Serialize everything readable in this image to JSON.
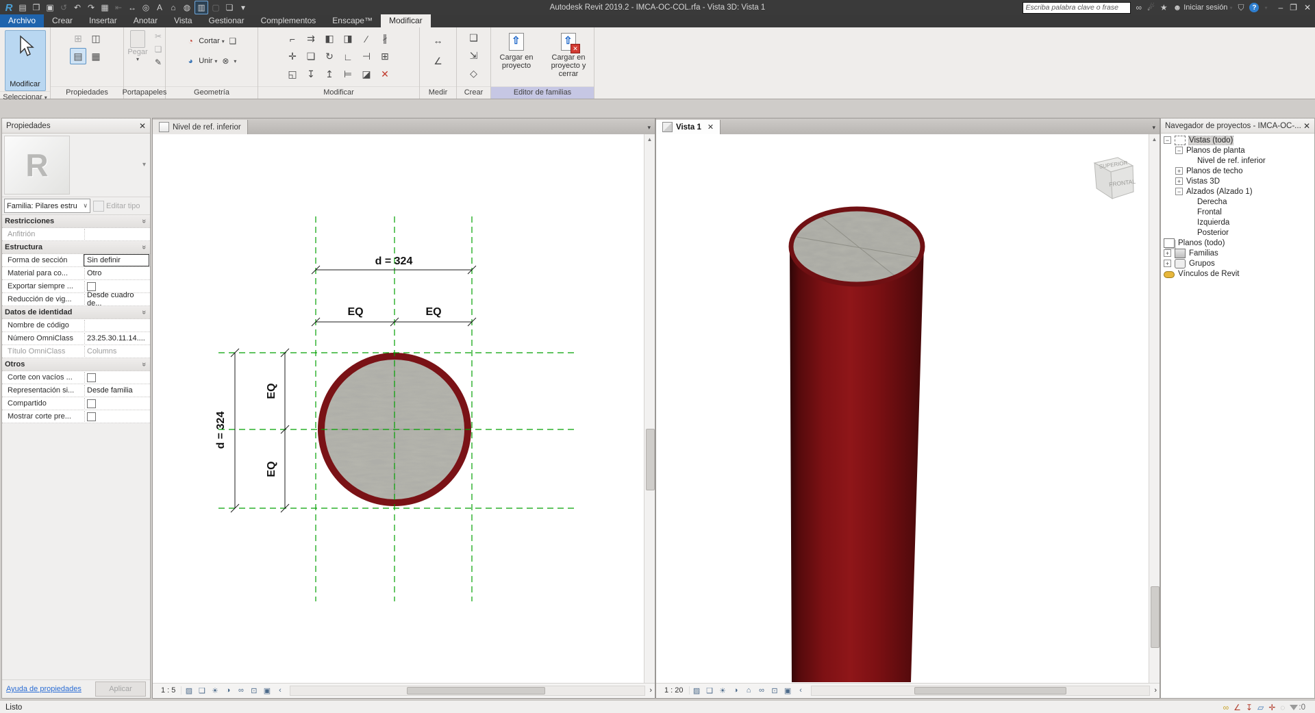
{
  "glyphs": {
    "close": "✕",
    "dropdown": "▾",
    "chevron": "»",
    "minimize": "–",
    "restore": "❐",
    "left_collapse": "‹",
    "right_arrow": "›",
    "up": "▲",
    "down": "▼"
  },
  "title_bar": {
    "title": "Autodesk Revit 2019.2 - IMCA-OC-COL.rfa - Vista 3D: Vista 1",
    "search_placeholder": "Escriba palabra clave o frase",
    "sign_in_label": "Iniciar sesión",
    "qat": [
      {
        "name": "revit-logo",
        "g": "R",
        "logo": true
      },
      {
        "name": "project-properties-icon",
        "g": "▤"
      },
      {
        "name": "open-icon",
        "g": "❒"
      },
      {
        "name": "save-icon",
        "g": "▣"
      },
      {
        "name": "sync-icon",
        "g": "↺",
        "dim": true
      },
      {
        "name": "undo-icon",
        "g": "↶"
      },
      {
        "name": "redo-icon",
        "g": "↷"
      },
      {
        "name": "print-icon",
        "g": "▦"
      },
      {
        "name": "measure-icon",
        "g": "⇤",
        "dim": true
      },
      {
        "name": "aligned-dimension-icon",
        "g": "↔"
      },
      {
        "name": "tag-icon",
        "g": "◎"
      },
      {
        "name": "text-icon",
        "g": "A"
      },
      {
        "name": "default-3d-view-icon",
        "g": "⌂"
      },
      {
        "name": "render-icon",
        "g": "◍"
      },
      {
        "name": "thin-lines-icon",
        "g": "▥",
        "boxed": true
      },
      {
        "name": "close-hidden-windows-icon",
        "g": "▢",
        "dim": true
      },
      {
        "name": "switch-windows-icon",
        "g": "❏"
      },
      {
        "name": "customize-qat-icon",
        "g": "▾"
      }
    ]
  },
  "tabs": [
    {
      "label": "Archivo",
      "archivo": true
    },
    {
      "label": "Crear"
    },
    {
      "label": "Insertar"
    },
    {
      "label": "Anotar"
    },
    {
      "label": "Vista"
    },
    {
      "label": "Gestionar"
    },
    {
      "label": "Complementos"
    },
    {
      "label": "Enscape™"
    },
    {
      "label": "Modificar",
      "active": true
    }
  ],
  "ribbon": {
    "select_big_label": "Modificar",
    "paste_label": "Pegar",
    "cut_label": "Cortar",
    "join_label": "Unir",
    "load_line1": "Cargar en",
    "load_line2": "proyecto",
    "loadclose_line1": "Cargar en",
    "loadclose_line2": "proyecto y cerrar",
    "panel_labels": {
      "select": "Seleccionar",
      "properties": "Propiedades",
      "clipboard": "Portapapeles",
      "geometry": "Geometría",
      "modify": "Modificar",
      "measure": "Medir",
      "create": "Crear",
      "family_editor": "Editor de familias"
    },
    "properties_icons": [
      {
        "name": "properties-palette-icon",
        "g": "⊞",
        "dim": true
      },
      {
        "name": "family-category-icon",
        "g": "◫"
      },
      {
        "name": "properties-toggle-icon",
        "g": "▤",
        "active": true
      },
      {
        "name": "family-types-icon",
        "g": "▦"
      }
    ],
    "clipboard_icons": [
      {
        "name": "cut-to-clipboard-icon",
        "g": "✂",
        "dim": true
      },
      {
        "name": "copy-to-clipboard-icon",
        "g": "❏",
        "dim": true
      },
      {
        "name": "match-type-icon",
        "g": "✎"
      }
    ],
    "geometry_icons": {
      "cut_icon": "◔",
      "cube_icon": "❑",
      "join_icon": "◕",
      "attach_icon": "⊗"
    },
    "modify_icons": [
      {
        "name": "align-icon",
        "g": "⌐"
      },
      {
        "name": "offset-icon",
        "g": "⇉"
      },
      {
        "name": "mirror-pick-axis-icon",
        "g": "◧"
      },
      {
        "name": "mirror-draw-axis-icon",
        "g": "◨"
      },
      {
        "name": "split-element-icon",
        "g": "∕"
      },
      {
        "name": "split-with-gap-icon",
        "g": "∦"
      },
      {
        "name": "move-icon",
        "g": "✛"
      },
      {
        "name": "copy-icon",
        "g": "❏"
      },
      {
        "name": "rotate-icon",
        "g": "↻"
      },
      {
        "name": "trim-corner-icon",
        "g": "∟"
      },
      {
        "name": "trim-extend-single-icon",
        "g": "⊣"
      },
      {
        "name": "array-icon",
        "g": "⊞"
      },
      {
        "name": "scale-icon",
        "g": "◱"
      },
      {
        "name": "pin-icon",
        "g": "↧"
      },
      {
        "name": "unpin-icon",
        "g": "↥"
      },
      {
        "name": "trim-extend-multiple-icon",
        "g": "⊨"
      },
      {
        "name": "split-face-icon",
        "g": "◪"
      },
      {
        "name": "delete-icon",
        "g": "✕",
        "red": true
      }
    ],
    "measure_icons": [
      {
        "name": "measure-length-icon",
        "g": "↔"
      },
      {
        "name": "angular-dimension-icon",
        "g": "∠"
      }
    ],
    "create_icons": [
      {
        "name": "component-in-place-icon",
        "g": "❑"
      },
      {
        "name": "transfer-small-icon",
        "g": "⇲"
      },
      {
        "name": "diamond-small-icon",
        "g": "◇"
      }
    ]
  },
  "properties_palette": {
    "header": "Propiedades",
    "type_selector": "Familia: Pilares estru",
    "edit_type_label": "Editar tipo",
    "rows": [
      {
        "sec": true,
        "label": "Restricciones"
      },
      {
        "label": "Anfitrión",
        "value": "",
        "disabled": true
      },
      {
        "sec": true,
        "label": "Estructura"
      },
      {
        "label": "Forma de sección",
        "value": "Sin definir",
        "selected": true
      },
      {
        "label": "Material para co...",
        "value": "Otro"
      },
      {
        "label": "Exportar siempre ...",
        "value": "",
        "checkbox": true
      },
      {
        "label": "Reducción de vig...",
        "value": "Desde cuadro de..."
      },
      {
        "sec": true,
        "label": "Datos de identidad"
      },
      {
        "label": "Nombre de código",
        "value": ""
      },
      {
        "label": "Número OmniClass",
        "value": "23.25.30.11.14...."
      },
      {
        "label": "Título OmniClass",
        "value": "Columns",
        "disabled": true
      },
      {
        "sec": true,
        "label": "Otros"
      },
      {
        "label": "Corte con vacíos ...",
        "value": "",
        "checkbox": true
      },
      {
        "label": "Representación si...",
        "value": "Desde familia"
      },
      {
        "label": "Compartido",
        "value": "",
        "checkbox": true
      },
      {
        "label": "Mostrar corte pre...",
        "value": "",
        "checkbox": true
      }
    ],
    "help_link": "Ayuda de propiedades",
    "apply_label": "Aplicar"
  },
  "plan_view": {
    "tab_label": "Nivel de ref. inferior",
    "scale": "1 : 5",
    "dim_d": "d = 324",
    "eq_label": "EQ",
    "controls": [
      {
        "name": "detail-level-icon",
        "g": "▨"
      },
      {
        "name": "visual-style-icon",
        "g": "❑"
      },
      {
        "name": "sun-path-icon",
        "g": "☀"
      },
      {
        "name": "shadows-icon",
        "g": "◑"
      },
      {
        "name": "temporary-hide-isolate-icon",
        "g": "∞"
      },
      {
        "name": "crop-view-icon",
        "g": "⊡"
      },
      {
        "name": "show-crop-region-icon",
        "g": "▣"
      },
      {
        "name": "collapse-bar-icon",
        "g": "‹"
      }
    ]
  },
  "view3d": {
    "tab_label": "Vista 1",
    "scale": "1 : 20",
    "viewcube_top": "SUPERIOR",
    "viewcube_front": "FRONTAL",
    "controls": [
      {
        "name": "detail-level-icon",
        "g": "▨"
      },
      {
        "name": "visual-style-icon",
        "g": "❑"
      },
      {
        "name": "sun-path-off-icon",
        "g": "☀"
      },
      {
        "name": "shadows-icon",
        "g": "◑"
      },
      {
        "name": "locked-3d-view-icon",
        "g": "⌂"
      },
      {
        "name": "temporary-hide-isolate-icon",
        "g": "∞"
      },
      {
        "name": "crop-view-icon",
        "g": "⊡"
      },
      {
        "name": "show-crop-region-icon",
        "g": "▣"
      },
      {
        "name": "collapse-bar-icon",
        "g": "‹"
      }
    ]
  },
  "project_browser": {
    "header": "Navegador de proyectos - IMCA-OC-...",
    "tree": [
      {
        "label": "Vistas (todo)",
        "exp": "minus",
        "icon": "ic-views",
        "sel": true
      },
      {
        "label": "Planos de planta",
        "exp": "minus",
        "l1": true
      },
      {
        "label": "Nivel de ref. inferior",
        "l2": true
      },
      {
        "label": "Planos de techo",
        "exp": "plus",
        "l1": true
      },
      {
        "label": "Vistas 3D",
        "exp": "plus",
        "l1": true
      },
      {
        "label": "Alzados (Alzado 1)",
        "exp": "minus",
        "l1": true
      },
      {
        "label": "Derecha",
        "l2": true
      },
      {
        "label": "Frontal",
        "l2": true
      },
      {
        "label": "Izquierda",
        "l2": true
      },
      {
        "label": "Posterior",
        "l2": true
      },
      {
        "label": "Planos (todo)",
        "icon": "ic-sheet"
      },
      {
        "label": "Familias",
        "exp": "plus",
        "icon": "ic-family"
      },
      {
        "label": "Grupos",
        "exp": "plus",
        "icon": "ic-group"
      },
      {
        "label": "Vínculos de Revit",
        "icon": "ic-link"
      }
    ]
  },
  "status_bar": {
    "text": "Listo",
    "filter_count": ":0",
    "icons": [
      {
        "name": "select-links-icon",
        "g": "∞",
        "cls": "c-yellow"
      },
      {
        "name": "select-underlay-icon",
        "g": "∠",
        "cls": "c-red"
      },
      {
        "name": "select-pinned-icon",
        "g": "↧",
        "cls": "c-red"
      },
      {
        "name": "select-by-face-icon",
        "g": "▱",
        "cls": "c-blue"
      },
      {
        "name": "drag-on-selection-icon",
        "g": "✛",
        "cls": "c-red"
      },
      {
        "name": "background-processes-icon",
        "g": "◌",
        "cls": "c-gray"
      }
    ]
  }
}
